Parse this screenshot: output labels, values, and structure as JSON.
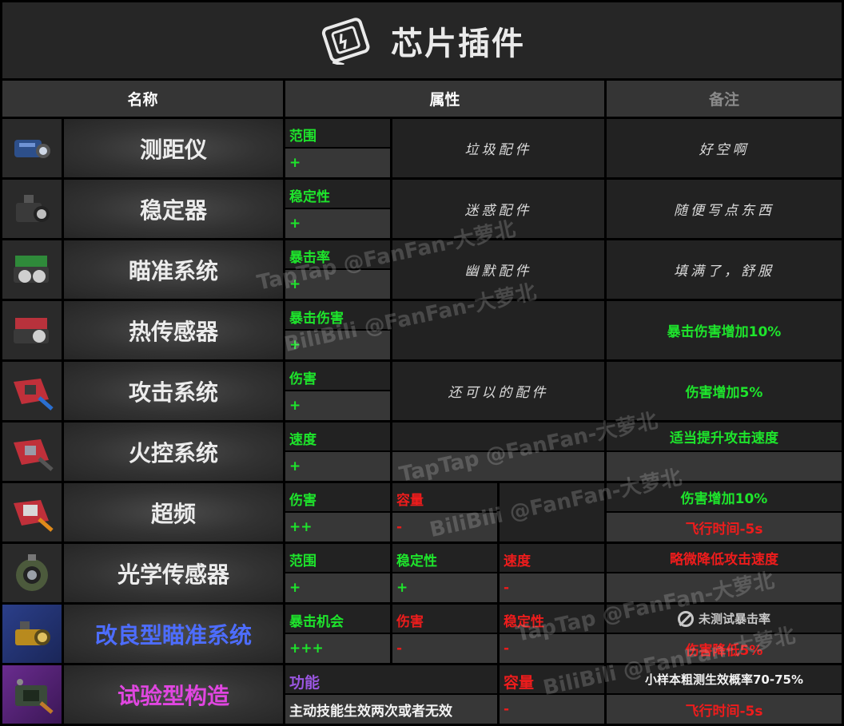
{
  "title": "芯片插件",
  "headers": {
    "name": "名称",
    "attributes": "属性",
    "notes": "备注"
  },
  "rows": [
    {
      "name": "测距仪",
      "attr_labels": [
        "范围"
      ],
      "attr_values": [
        "+"
      ],
      "desc": "垃圾配件",
      "note": "好空啊"
    },
    {
      "name": "稳定器",
      "attr_labels": [
        "稳定性"
      ],
      "attr_values": [
        "+"
      ],
      "desc": "迷惑配件",
      "note": "随便写点东西"
    },
    {
      "name": "瞄准系统",
      "attr_labels": [
        "暴击率"
      ],
      "attr_values": [
        "+"
      ],
      "desc": "幽默配件",
      "note": "填满了，舒服"
    },
    {
      "name": "热传感器",
      "attr_labels": [
        "暴击伤害"
      ],
      "attr_values": [
        "+"
      ],
      "note": "暴击伤害增加10%"
    },
    {
      "name": "攻击系统",
      "attr_labels": [
        "伤害"
      ],
      "attr_values": [
        "+"
      ],
      "desc": "还可以的配件",
      "note": "伤害增加5%"
    },
    {
      "name": "火控系统",
      "attr_labels": [
        "速度"
      ],
      "attr_values": [
        "+"
      ],
      "note": "适当提升攻击速度"
    },
    {
      "name": "超频",
      "attr_labels": [
        "伤害",
        "容量"
      ],
      "attr_values": [
        "++",
        "-"
      ],
      "note": "伤害增加10%",
      "note2": "飞行时间-5s"
    },
    {
      "name": "光学传感器",
      "attr_labels": [
        "范围",
        "稳定性",
        "速度"
      ],
      "attr_values": [
        "+",
        "+",
        "-"
      ],
      "note": "略微降低攻击速度"
    },
    {
      "name": "改良型瞄准系统",
      "attr_labels": [
        "暴击机会",
        "伤害",
        "稳定性"
      ],
      "attr_values": [
        "+++",
        "-",
        "-"
      ],
      "note": "未测试暴击率",
      "note2": "伤害降低5%"
    },
    {
      "name": "试验型构造",
      "attr_labels": [
        "功能",
        "容量"
      ],
      "attr_values": [
        "主动技能生效两次或者无效",
        "-"
      ],
      "note": "小样本粗测生效概率70-75%",
      "note2": "飞行时间-5s"
    }
  ],
  "watermarks": [
    "TapTap @FanFan-大萝北",
    "BiliBili @FanFan-大萝北",
    "TapTap @FanFan-大萝北",
    "BiliBili @FanFan-大萝北",
    "TapTap @FanFan-大萝北",
    "BiliBili @FanFan-大萝北"
  ],
  "colors": {
    "positive": "#1ee52c",
    "negative": "#ee1c1c",
    "feature": "#9a56e0",
    "improved_name": "#4d6dff",
    "experimental_name": "#e046e0"
  },
  "icons": [
    "rangefinder-chip-icon",
    "stabilizer-chip-icon",
    "targeting-chip-icon",
    "thermal-sensor-chip-icon",
    "attack-chip-icon",
    "fire-control-chip-icon",
    "overclock-chip-icon",
    "optical-sensor-chip-icon",
    "improved-targeting-chip-icon",
    "experimental-construct-chip-icon",
    "chip-card-icon"
  ]
}
